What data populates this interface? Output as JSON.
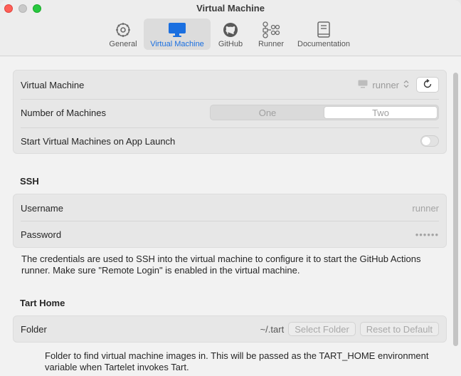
{
  "window": {
    "title": "Virtual Machine"
  },
  "tabs": [
    {
      "label": "General",
      "icon": "gear-icon"
    },
    {
      "label": "Virtual Machine",
      "icon": "monitor-icon",
      "active": true
    },
    {
      "label": "GitHub",
      "icon": "github-icon"
    },
    {
      "label": "Runner",
      "icon": "workflow-icon"
    },
    {
      "label": "Documentation",
      "icon": "book-icon"
    }
  ],
  "vm": {
    "label": "Virtual Machine",
    "selected": "runner",
    "machines_label": "Number of Machines",
    "machines_options": [
      "One",
      "Two"
    ],
    "machines_selected": "Two",
    "launch_label": "Start Virtual Machines on App Launch",
    "launch_on": false
  },
  "ssh": {
    "title": "SSH",
    "username_label": "Username",
    "username_value": "runner",
    "password_label": "Password",
    "password_value": "••••••",
    "note": "The credentials are used to SSH into the virtual machine to configure it to start the GitHub Actions runner. Make sure \"Remote Login\" is enabled in the virtual machine."
  },
  "tart": {
    "title": "Tart Home",
    "folder_label": "Folder",
    "folder_value": "~/.tart",
    "select_folder": "Select Folder",
    "reset_default": "Reset to Default",
    "note": "Folder to find virtual machine images in. This will be passed as the TART_HOME environment variable when Tartelet invokes Tart."
  },
  "colors": {
    "accent": "#1a6fe0",
    "close": "#fe5f57",
    "zoom": "#28c840"
  }
}
